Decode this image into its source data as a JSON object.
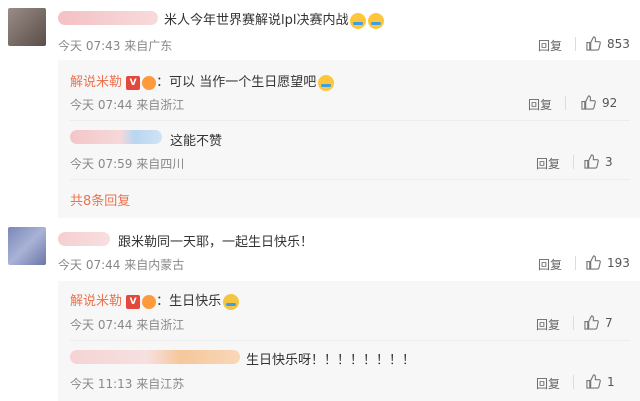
{
  "comments": [
    {
      "text": "米人今年世界赛解说lpl决赛内战",
      "emoji_count": 2,
      "meta": "今天 07:43 来自广东",
      "reply_label": "回复",
      "likes": "853",
      "replies": [
        {
          "author": "解说米勒",
          "text": "：可以 当作一个生日愿望吧",
          "meta": "今天 07:44 来自浙江",
          "reply_label": "回复",
          "likes": "92"
        },
        {
          "text": "这能不赞",
          "meta": "今天 07:59 来自四川",
          "reply_label": "回复",
          "likes": "3"
        }
      ],
      "more_replies": "共8条回复"
    },
    {
      "text": "跟米勒同一天耶，一起生日快乐！",
      "meta": "今天 07:44 来自内蒙古",
      "reply_label": "回复",
      "likes": "193",
      "replies": [
        {
          "author": "解说米勒",
          "text": "：生日快乐",
          "meta": "今天 07:44 来自浙江",
          "reply_label": "回复",
          "likes": "7"
        },
        {
          "text": "生日快乐呀！！！！！！！！",
          "meta": "今天 11:13 来自江苏",
          "reply_label": "回复",
          "likes": "1"
        }
      ]
    }
  ],
  "colors": {
    "author": "#eb7350",
    "meta": "#888888",
    "reply_bg": "#f7f7f7"
  },
  "icons": {
    "like": "thumbs-up-icon",
    "verified": "v-badge-icon"
  }
}
